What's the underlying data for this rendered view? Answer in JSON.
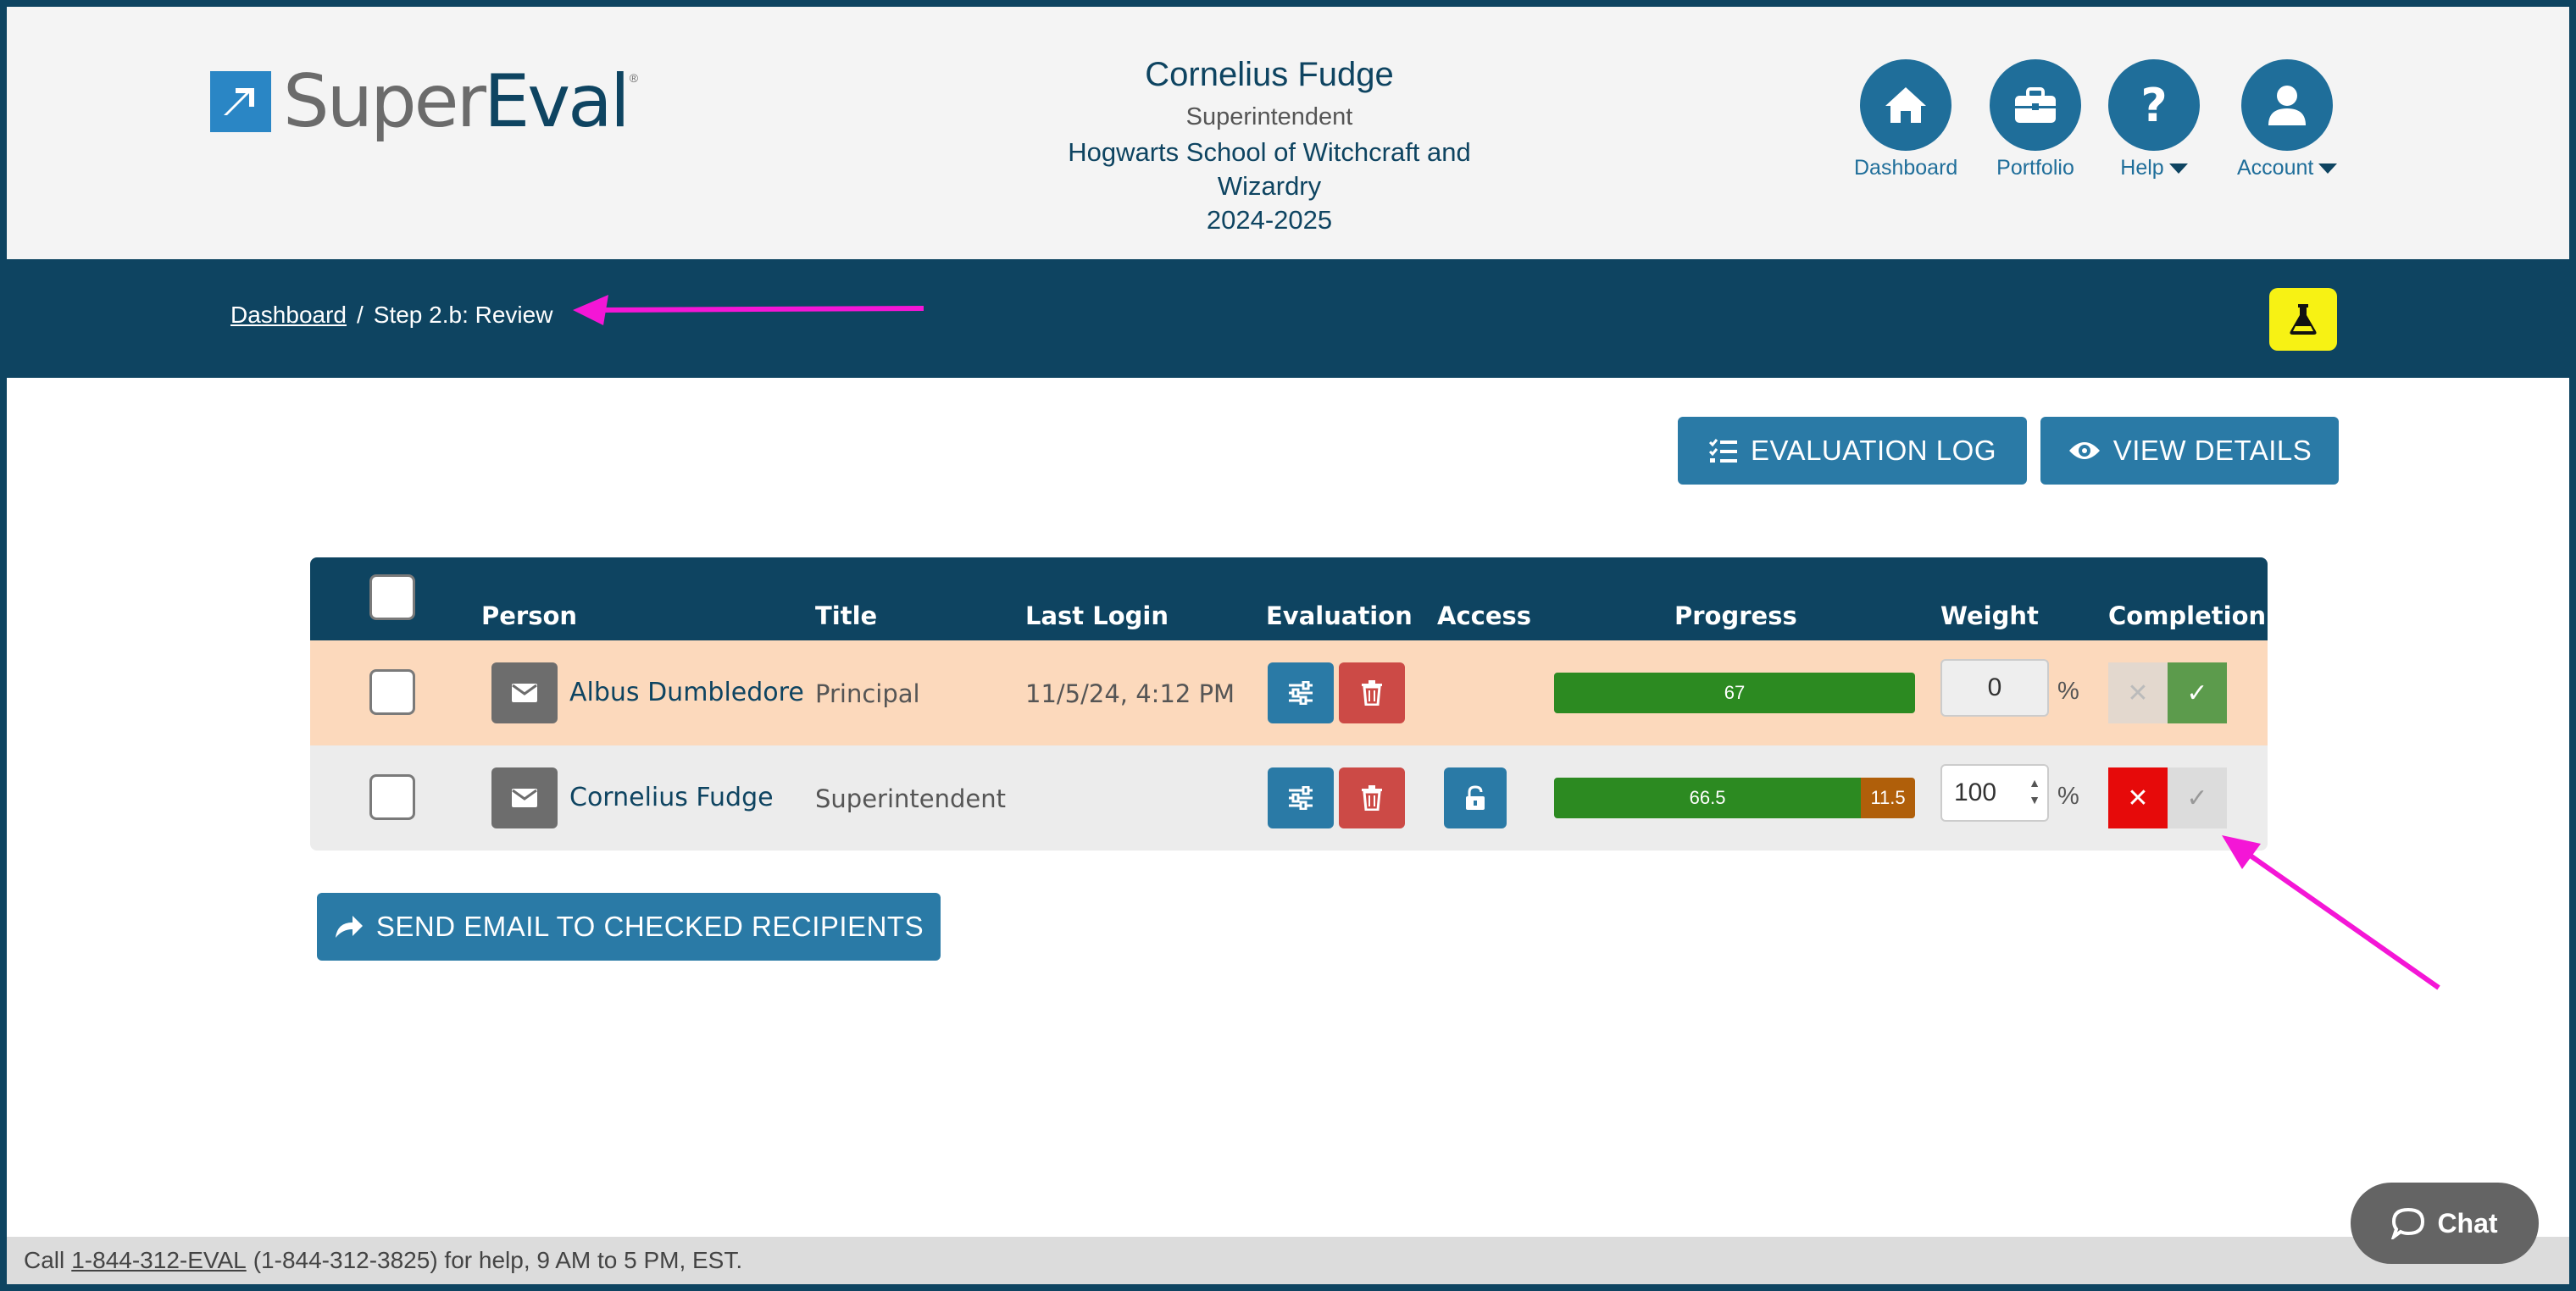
{
  "header": {
    "logo": {
      "super": "Super",
      "eval": "Eval",
      "reg": "®"
    },
    "user": {
      "name": "Cornelius Fudge",
      "role": "Superintendent",
      "school_line1": "Hogwarts School of Witchcraft and",
      "school_line2": "Wizardry",
      "year": "2024-2025"
    },
    "nav": {
      "dashboard": "Dashboard",
      "portfolio": "Portfolio",
      "help": "Help",
      "account": "Account"
    }
  },
  "breadcrumb": {
    "home": "Dashboard",
    "separator": "/",
    "current": "Step 2.b: Review"
  },
  "actions": {
    "evaluation_log": "EVALUATION LOG",
    "view_details": "VIEW DETAILS",
    "send_email": "SEND EMAIL TO CHECKED RECIPIENTS"
  },
  "table": {
    "headers": {
      "person": "Person",
      "title": "Title",
      "last_login": "Last Login",
      "evaluation": "Evaluation",
      "access": "Access",
      "progress": "Progress",
      "weight": "Weight",
      "completion": "Completion"
    },
    "rows": [
      {
        "person": "Albus Dumbledore",
        "title": "Principal",
        "last_login": "11/5/24, 4:12 PM",
        "progress_green": "67",
        "progress_green_fraction": 1.0,
        "weight": "0",
        "weight_unit": "%"
      },
      {
        "person": "Cornelius Fudge",
        "title": "Superintendent",
        "last_login": "",
        "progress_green": "66.5",
        "progress_orange": "11.5",
        "progress_green_fraction": 0.85,
        "progress_orange_fraction": 0.15,
        "weight": "100",
        "weight_unit": "%"
      }
    ]
  },
  "footer": {
    "prefix": "Call",
    "phone_link": "1-844-312-EVAL",
    "suffix": "(1-844-312-3825) for help, 9 AM to 5 PM, EST."
  },
  "chat": {
    "label": "Chat"
  },
  "colors": {
    "navy": "#0e4461",
    "blue": "#2a7aa6",
    "red": "#cc4a46",
    "progress_green": "#2c8a21",
    "progress_orange": "#b05f0a",
    "annotation_arrow": "#f416d6"
  }
}
